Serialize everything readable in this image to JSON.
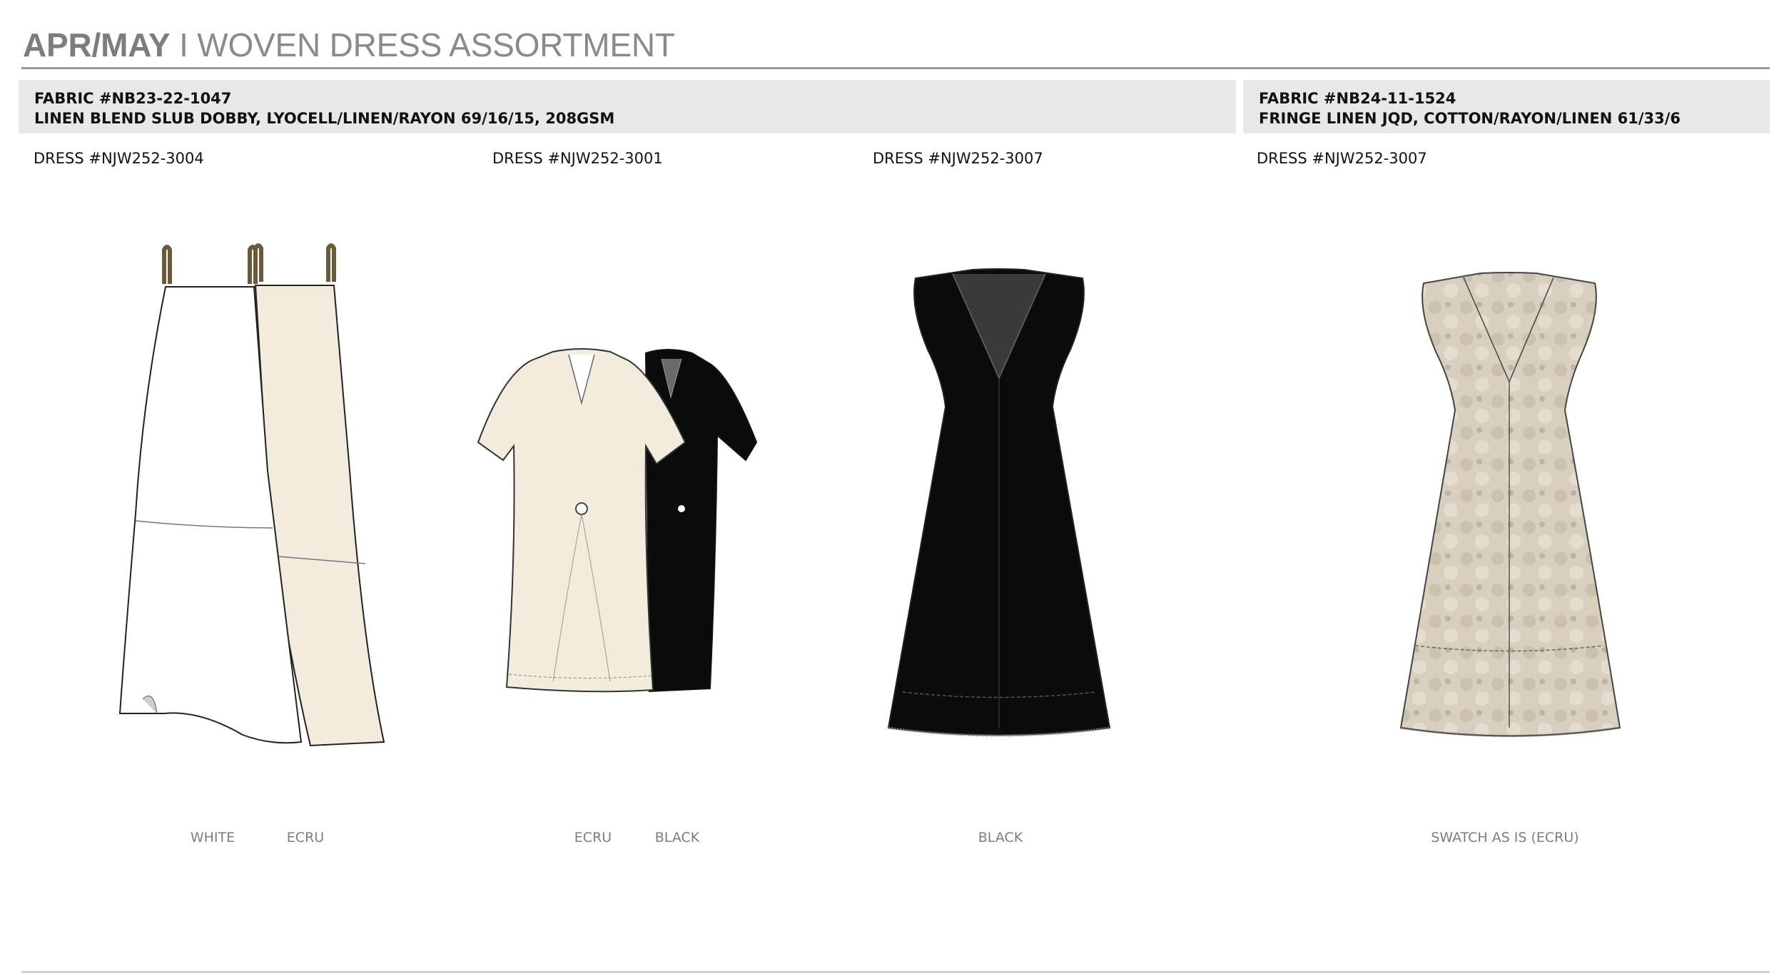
{
  "header": {
    "title_bold": "APR/MAY",
    "title_rest": " I WOVEN DRESS ASSORTMENT"
  },
  "fabrics": [
    {
      "number": "FABRIC #NB23-22-1047",
      "description": "LINEN BLEND SLUB DOBBY, LYOCELL/LINEN/RAYON 69/16/15, 208GSM"
    },
    {
      "number": "FABRIC #NB24-11-1524",
      "description": "FRINGE LINEN JQD, COTTON/RAYON/LINEN 61/33/6"
    }
  ],
  "dresses": [
    {
      "label": "DRESS #NJW252-3004",
      "colors": [
        "WHITE",
        "ECRU"
      ]
    },
    {
      "label": "DRESS #NJW252-3001",
      "colors": [
        "ECRU",
        "BLACK"
      ]
    },
    {
      "label": "DRESS #NJW252-3007",
      "colors": [
        "BLACK"
      ]
    },
    {
      "label": "DRESS #NJW252-3007",
      "colors": [
        "SWATCH AS IS (ECRU)"
      ]
    }
  ],
  "palette": {
    "white": "#ffffff",
    "ecru": "#f3ecdc",
    "black": "#0b0b0b",
    "swatch": "#d8cfbf",
    "header_bg": "#e8e8e8"
  }
}
